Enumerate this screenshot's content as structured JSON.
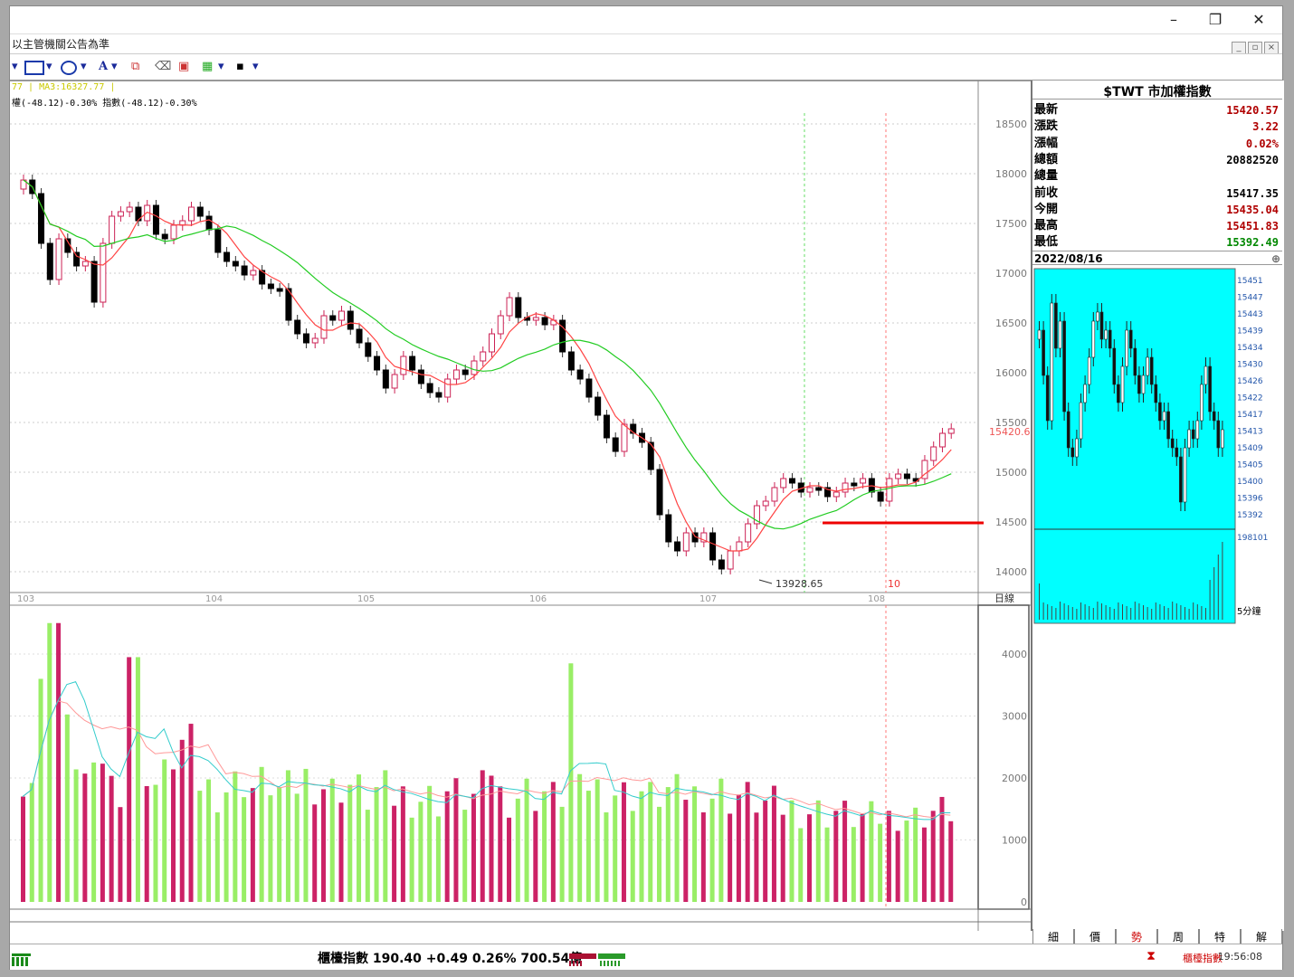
{
  "window": {
    "minimize": "–",
    "restore": "❐",
    "close": "✕"
  },
  "menubar": {
    "caption": "以主管機關公告為準"
  },
  "legend": {
    "line1": "77 | MA3:16327.77 |",
    "line2": "權(-48.12)-0.30% 指數(-48.12)-0.30%"
  },
  "price_axis": [
    "18500",
    "18000",
    "17500",
    "17000",
    "16500",
    "16000",
    "15500",
    "15000",
    "14500",
    "14000"
  ],
  "volume_axis": [
    "4000",
    "3000",
    "2000",
    "1000",
    "0"
  ],
  "x_labels": [
    "103",
    "104",
    "105",
    "106",
    "107",
    "108"
  ],
  "annotations": {
    "low_label": "13928.65",
    "last_price": "15420.6",
    "day_marker": "10",
    "period": "日線"
  },
  "quote": {
    "title": "$TWT 市加權指數",
    "rows": [
      {
        "label": "最新",
        "value": "15420.57",
        "color": "#b00000"
      },
      {
        "label": "漲跌",
        "value": "3.22",
        "color": "#b00000"
      },
      {
        "label": "漲幅",
        "value": "0.02%",
        "color": "#b00000"
      },
      {
        "label": "總額",
        "value": "20882520",
        "color": "#000000"
      },
      {
        "label": "總量",
        "value": "",
        "color": "#000000"
      },
      {
        "label": "前收",
        "value": "15417.35",
        "color": "#000000"
      },
      {
        "label": "今開",
        "value": "15435.04",
        "color": "#b00000"
      },
      {
        "label": "最高",
        "value": "15451.83",
        "color": "#b00000"
      },
      {
        "label": "最低",
        "value": "15392.49",
        "color": "#008800"
      }
    ],
    "date": "2022/08/16"
  },
  "intraday": {
    "axis": [
      "15451",
      "15447",
      "15443",
      "15439",
      "15434",
      "15430",
      "15426",
      "15422",
      "15417",
      "15413",
      "15409",
      "15405",
      "15400",
      "15396",
      "15392"
    ],
    "volume_label": "198101",
    "period": "5分鐘"
  },
  "tabs": [
    "細",
    "價",
    "勢",
    "周",
    "特",
    "解"
  ],
  "status": {
    "text": "櫃檯指數 190.40 +0.49 0.26% 700.54億",
    "ticker": "櫃檯指數",
    "clock": "19:56:08"
  },
  "colors": {
    "up": "#cc2255",
    "down": "#000000",
    "vol_up": "#cc2266",
    "vol_down": "#99ee66",
    "ma_short": "#ff4444",
    "ma_long": "#22cc22",
    "intraday_bg": "#00ffff"
  }
}
